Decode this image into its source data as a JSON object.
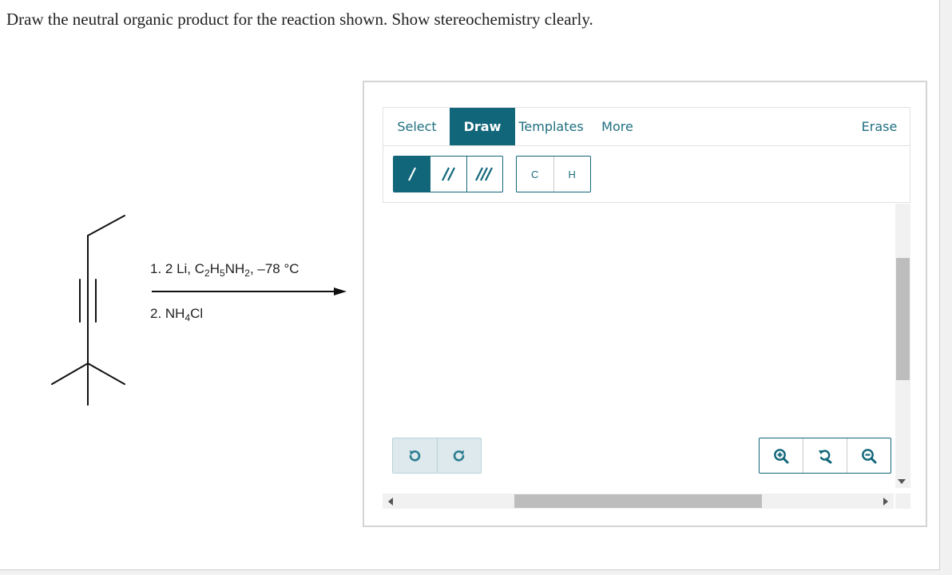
{
  "question": "Draw the neutral organic product for the reaction shown. Show stereochemistry clearly.",
  "reaction": {
    "step1": {
      "prefix": "1. 2 Li, C",
      "sub1": "2",
      "mid1": "H",
      "sub2": "5",
      "mid2": "NH",
      "sub3": "2",
      "suffix": ", –78 °C"
    },
    "step2": {
      "prefix": "2. NH",
      "sub1": "4",
      "suffix": "Cl"
    }
  },
  "editor": {
    "tabs": {
      "select": "Select",
      "draw": "Draw",
      "templates": "Templates",
      "more": "More",
      "erase": "Erase"
    },
    "active_tab": "Draw",
    "bond_tools": [
      "single-bond-icon",
      "double-bond-icon",
      "triple-bond-icon"
    ],
    "active_bond": "single",
    "atoms": {
      "carbon": "C",
      "hydrogen": "H"
    },
    "history_tools": [
      "undo-icon",
      "redo-icon"
    ],
    "zoom_tools": [
      "zoom-in-icon",
      "zoom-reset-icon",
      "zoom-out-icon"
    ],
    "accent_color": "#11667a"
  }
}
